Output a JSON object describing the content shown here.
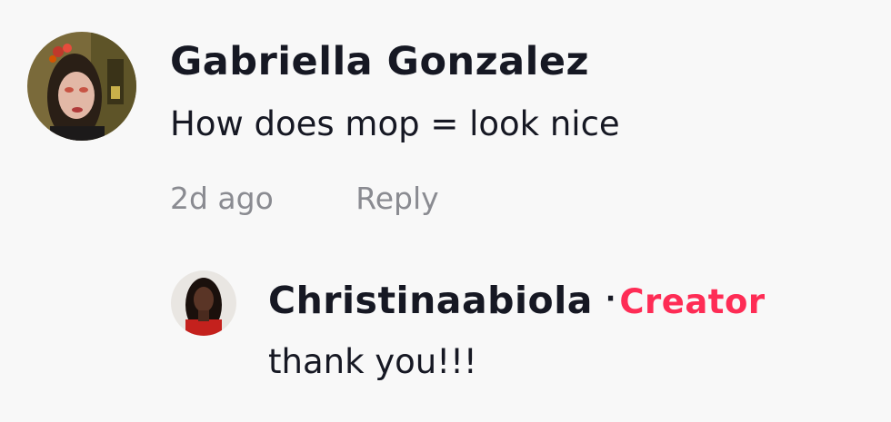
{
  "comment": {
    "username": "Gabriella Gonzalez",
    "text": "How does mop = look nice",
    "timestamp": "2d ago",
    "reply_label": "Reply",
    "avatar_icon": "user-avatar-photo"
  },
  "reply": {
    "username": "Christinaabiola",
    "separator": "·",
    "badge": "Creator",
    "text": "thank you!!!",
    "avatar_icon": "creator-avatar-photo"
  },
  "colors": {
    "background": "#f8f8f8",
    "text": "#161823",
    "muted": "#8a8b91",
    "creator_accent": "#fe2c55"
  }
}
